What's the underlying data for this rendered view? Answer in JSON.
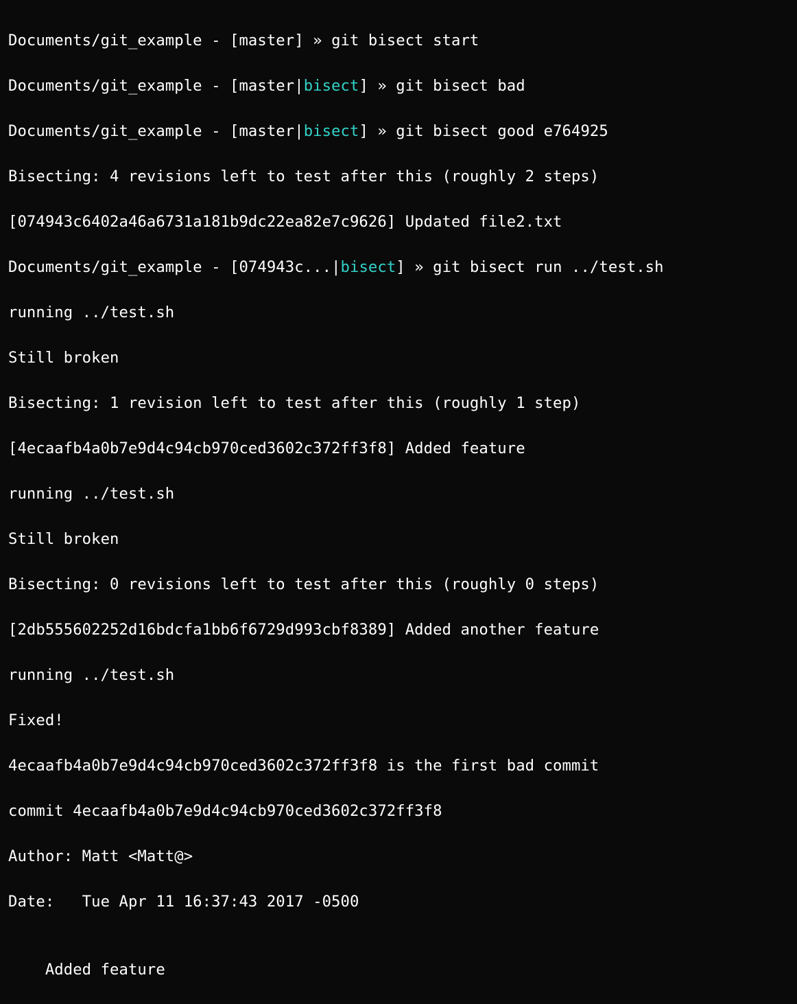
{
  "terminal": {
    "colors": {
      "bg": "#0a0a0a",
      "fg": "#ffffff",
      "bisect": "#32d2c8"
    },
    "prompt": {
      "path": "Documents/git_example",
      "dash": " - ",
      "lbrack": "[",
      "rbrack": "]",
      "pipe": "|",
      "arrow": " » "
    },
    "lines": {
      "l1_branch": "master",
      "l1_cmd": "git bisect start",
      "l2_branch": "master",
      "l2_bisect": "bisect",
      "l2_cmd": "git bisect bad",
      "l3_branch": "master",
      "l3_bisect": "bisect",
      "l3_cmd": "git bisect good e764925",
      "l4": "Bisecting: 4 revisions left to test after this (roughly 2 steps)",
      "l5": "[074943c6402a46a6731a181b9dc22ea82e7c9626] Updated file2.txt",
      "l6_branch": "074943c...",
      "l6_bisect": "bisect",
      "l6_cmd": "git bisect run ../test.sh",
      "l7": "running ../test.sh",
      "l8": "Still broken",
      "l9": "Bisecting: 1 revision left to test after this (roughly 1 step)",
      "l10": "[4ecaafb4a0b7e9d4c94cb970ced3602c372ff3f8] Added feature",
      "l11": "running ../test.sh",
      "l12": "Still broken",
      "l13": "Bisecting: 0 revisions left to test after this (roughly 0 steps)",
      "l14": "[2db555602252d16bdcfa1bb6f6729d993cbf8389] Added another feature",
      "l15": "running ../test.sh",
      "l16": "Fixed!",
      "l17": "4ecaafb4a0b7e9d4c94cb970ced3602c372ff3f8 is the first bad commit",
      "l18": "commit 4ecaafb4a0b7e9d4c94cb970ced3602c372ff3f8",
      "l19": "Author: Matt <Matt@>",
      "l20": "Date:   Tue Apr 11 16:37:43 2017 -0500",
      "l21": "",
      "l22": "    Added feature"
    }
  }
}
